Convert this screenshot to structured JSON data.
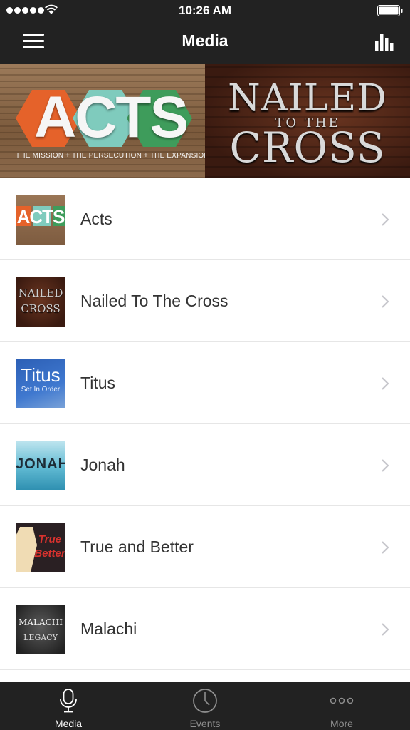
{
  "status_bar": {
    "time": "10:26 AM",
    "signal_icon": "signal-dots-icon",
    "wifi_icon": "wifi-icon",
    "battery_icon": "battery-icon"
  },
  "nav": {
    "title": "Media",
    "menu_icon": "hamburger-menu-icon",
    "stats_icon": "bar-chart-icon"
  },
  "banner": {
    "acts": {
      "title": "ACTS",
      "subtitle": "THE MISSION + THE PERSECUTION + THE EXPANSION"
    },
    "nailed": {
      "line1": "NAILED",
      "line2": "TO THE",
      "line3": "CROSS"
    }
  },
  "list": {
    "items": [
      {
        "label": "Acts",
        "thumb_text": "ACTS"
      },
      {
        "label": "Nailed To The Cross",
        "thumb_text": "NAILED CROSS"
      },
      {
        "label": "Titus",
        "thumb_text": "Titus",
        "thumb_sub": "Set In Order"
      },
      {
        "label": "Jonah",
        "thumb_text": "JONAH"
      },
      {
        "label": "True and Better",
        "thumb_text": "True Better"
      },
      {
        "label": "Malachi",
        "thumb_text": "MALACHI",
        "thumb_sub": "LEGACY"
      }
    ],
    "chevron_icon": "chevron-right-icon"
  },
  "tabs": [
    {
      "label": "Media",
      "icon": "microphone-icon",
      "active": true
    },
    {
      "label": "Events",
      "icon": "clock-icon",
      "active": false
    },
    {
      "label": "More",
      "icon": "more-dots-icon",
      "active": false
    }
  ],
  "colors": {
    "bar": "#222222",
    "tab_active": "#ffffff",
    "tab_inactive": "#8e8e8e",
    "list_text": "#333333",
    "divider": "#e6e6e6"
  }
}
